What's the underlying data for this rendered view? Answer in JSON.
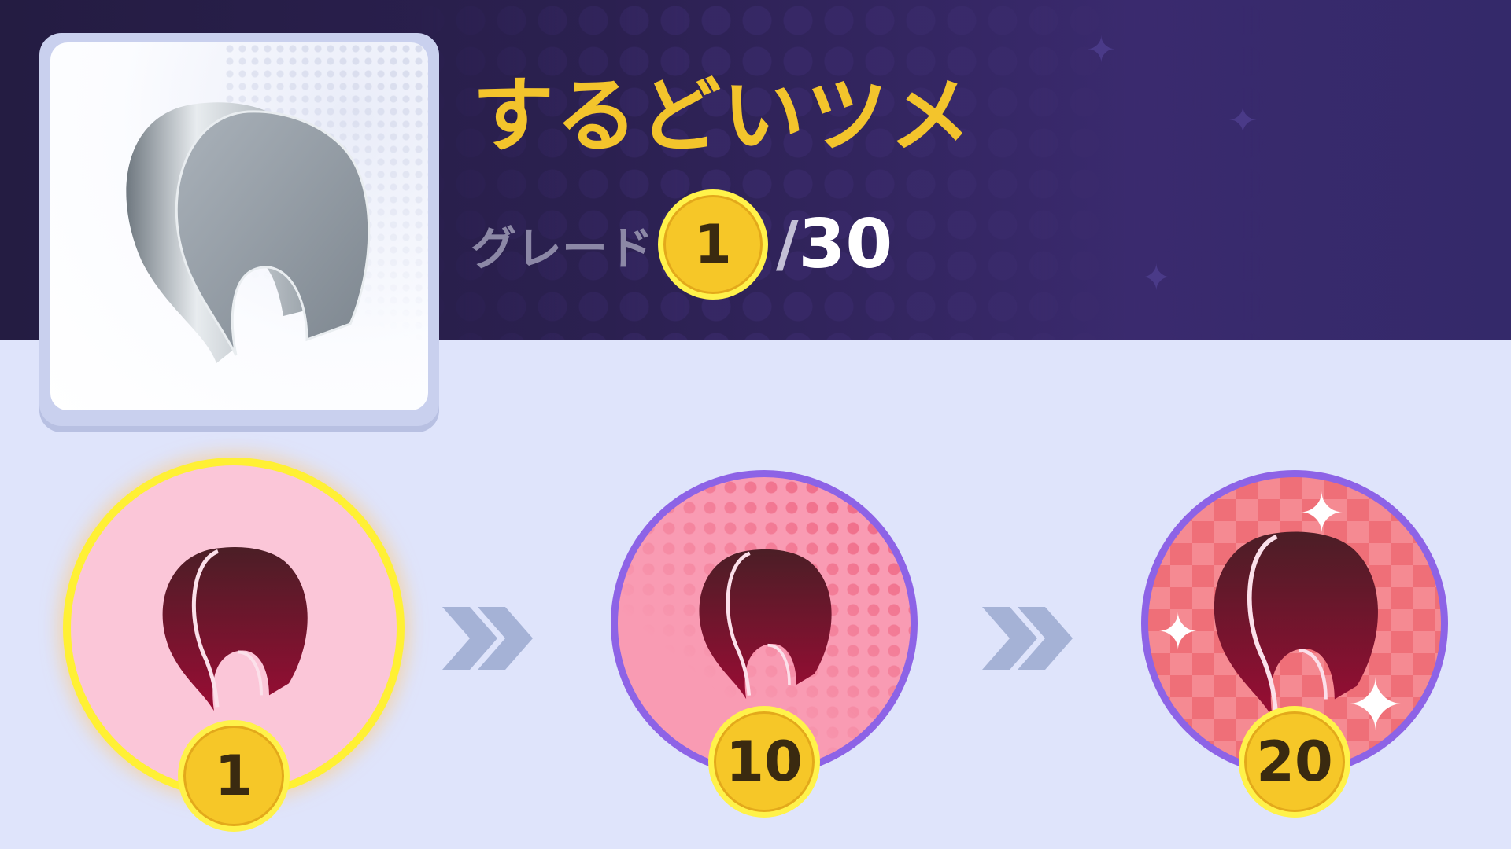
{
  "item": {
    "name": "するどいツメ",
    "icon": "sharp-claw-icon"
  },
  "grade": {
    "label": "グレード",
    "current": "1",
    "separator": "/",
    "max": "30"
  },
  "stages": [
    {
      "level": "1",
      "icon": "claw-stage-1-icon"
    },
    {
      "level": "10",
      "icon": "claw-stage-2-icon"
    },
    {
      "level": "20",
      "icon": "claw-stage-3-icon"
    }
  ],
  "colors": {
    "title": "#f3c42c",
    "badge": "#f6c728",
    "active_ring": "#fff034",
    "locked_ring": "#8d63e6",
    "banner": "#2b2050",
    "background": "#dfe4fb"
  }
}
